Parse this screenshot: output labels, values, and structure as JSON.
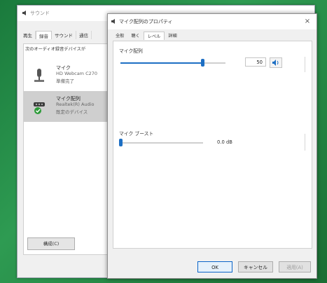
{
  "sound_window": {
    "title": "サウンド",
    "tabs": [
      "再生",
      "録音",
      "サウンド",
      "通信"
    ],
    "description": "次のオーディオ録音デバイスが",
    "devices": [
      {
        "name": "マイク",
        "sub": "HD Webcam C270",
        "status": "準備完了"
      },
      {
        "name": "マイク配列",
        "sub": "Realtek(R) Audio",
        "status": "既定のデバイス"
      }
    ],
    "configure_label": "構成(C)"
  },
  "props_window": {
    "title": "マイク配列のプロパティ",
    "close_glyph": "×",
    "tabs": [
      "全般",
      "聴く",
      "レベル",
      "詳細"
    ],
    "active_tab": "レベル",
    "mic_array": {
      "label": "マイク配列",
      "value": "50",
      "level_fraction": 0.78
    },
    "mic_boost": {
      "label": "マイク ブースト",
      "value": "0.0 dB",
      "level_fraction": 0.0
    },
    "buttons": {
      "ok": "OK",
      "cancel": "キャンセル",
      "apply": "適用(A)"
    }
  },
  "colors": {
    "accent": "#1d6fc4",
    "status_check": "#2e9b3a"
  }
}
